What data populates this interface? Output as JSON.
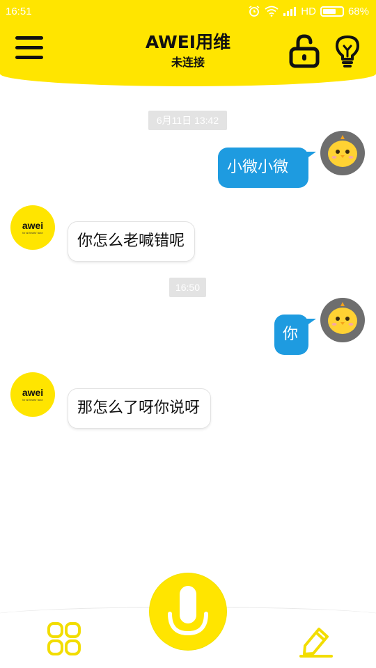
{
  "status_bar": {
    "time": "16:51",
    "network": "HD",
    "battery": "68%",
    "battery_level": 0.68,
    "icons": [
      "alarm-icon",
      "wifi-icon",
      "signal-icon",
      "battery-icon"
    ]
  },
  "header": {
    "title": "AWEI用维",
    "subtitle": "未连接",
    "menu_icon": "hamburger-menu-icon",
    "lock_icon": "unlock-icon",
    "bulb_icon": "lightbulb-icon"
  },
  "chat": {
    "timestamps": [
      "6月11日 13:42",
      "16:50"
    ],
    "messages": [
      {
        "from": "user",
        "text": "小微小微"
      },
      {
        "from": "bot",
        "text": "你怎么老喊错呢"
      },
      {
        "from": "user",
        "text": "你"
      },
      {
        "from": "bot",
        "text": "那怎么了呀你说呀"
      }
    ],
    "bot_logo_text": "awei",
    "bot_logo_tagline": "for all hearts' favor"
  },
  "bottom_bar": {
    "left_icon": "grid-apps-icon",
    "center_icon": "microphone-icon",
    "right_icon": "edit-pencil-icon"
  },
  "colors": {
    "accent": "#FFE500",
    "bubble_out": "#1E9BE0",
    "bubble_in": "#FFFFFF",
    "time_pill": "#E3E3E3"
  }
}
